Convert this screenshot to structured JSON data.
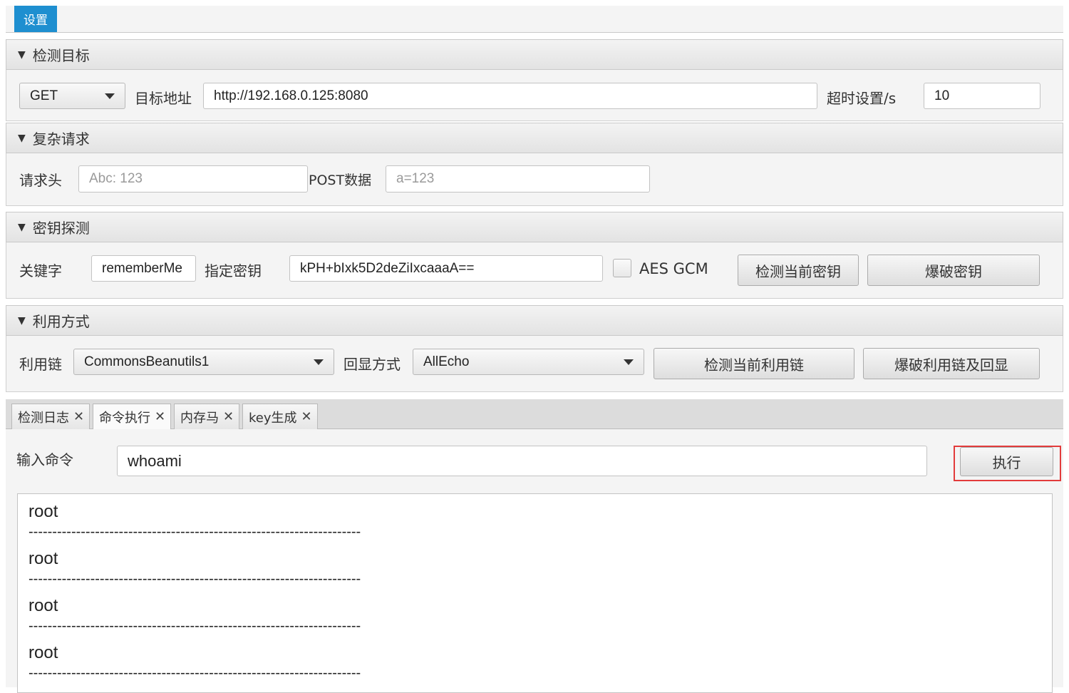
{
  "menu": {
    "settings_label": "设置"
  },
  "panes": {
    "target": {
      "title": "检测目标",
      "method": "GET",
      "url_label": "目标地址",
      "url_value": "http://192.168.0.125:8080",
      "timeout_label": "超时设置/s",
      "timeout_value": "10"
    },
    "complex": {
      "title": "复杂请求",
      "headers_label": "请求头",
      "headers_placeholder": "Abc: 123",
      "post_label": "POST数据",
      "post_placeholder": "a=123"
    },
    "key": {
      "title": "密钥探测",
      "keyword_label": "关键字",
      "keyword_value": "rememberMe",
      "key_label": "指定密钥",
      "key_value": "kPH+bIxk5D2deZiIxcaaaA==",
      "aes_gcm_label": "AES GCM",
      "aes_gcm_checked": false,
      "detect_key_button": "检测当前密钥",
      "brute_key_button": "爆破密钥"
    },
    "exploit": {
      "title": "利用方式",
      "chain_label": "利用链",
      "chain_value": "CommonsBeanutils1",
      "echo_label": "回显方式",
      "echo_value": "AllEcho",
      "detect_chain_button": "检测当前利用链",
      "brute_chain_button": "爆破利用链及回显"
    }
  },
  "tabs": [
    {
      "label": "检测日志",
      "close": "✕"
    },
    {
      "label": "命令执行",
      "close": "✕"
    },
    {
      "label": "内存马",
      "close": "✕"
    },
    {
      "label": "key生成",
      "close": "✕"
    }
  ],
  "command": {
    "input_label": "输入命令",
    "input_value": "whoami",
    "execute_button": "执行"
  },
  "output": {
    "lines": [
      "root",
      "root",
      "root",
      "root"
    ],
    "separator": "----------------------------------------------------------------------"
  }
}
